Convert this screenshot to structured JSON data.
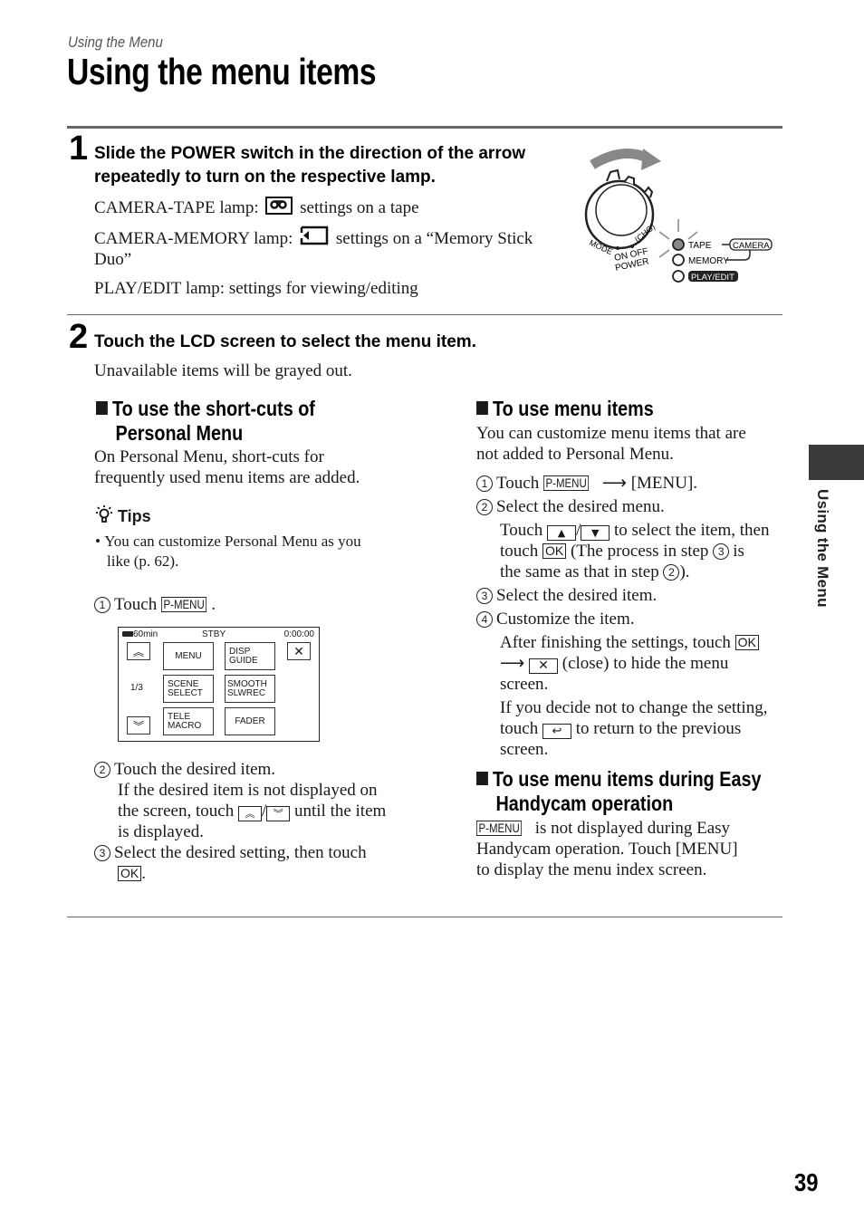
{
  "header": {
    "running_head": "Using the Menu",
    "title": "Using the menu items"
  },
  "step1": {
    "number": "1",
    "heading_line1": "Slide the POWER switch in the direction of the arrow",
    "heading_line2": "repeatedly to turn on the respective lamp.",
    "lines": [
      {
        "label": "CAMERA-TAPE lamp:",
        "icon": "tape-icon",
        "text": "settings on a tape"
      },
      {
        "label": "CAMERA-MEMORY lamp:",
        "icon": "memory-stick-icon",
        "text": "settings on a “Memory Stick",
        "text_cont": "Duo”"
      },
      {
        "label": "PLAY/EDIT lamp: settings for viewing/editing"
      }
    ],
    "diagram": {
      "mode": "MODE",
      "chg": "(CHG)",
      "on_off": "ON OFF",
      "power": "POWER",
      "tape": "TAPE",
      "memory": "MEMORY",
      "play_edit": "PLAY/EDIT",
      "camera": "CAMERA"
    }
  },
  "step2": {
    "number": "2",
    "heading": "Touch the LCD screen to select the menu item.",
    "subtext": "Unavailable items will be grayed out."
  },
  "left_col": {
    "section_title_line1": "To use the short-cuts of",
    "section_title_line2": "Personal Menu",
    "intro_line1": "On Personal Menu, short-cuts for",
    "intro_line2": "frequently used menu items are added.",
    "tips_label": "Tips",
    "tip_line1": "You can customize Personal Menu as you",
    "tip_line2": "like (p. 62).",
    "step1_touch": "Touch",
    "pmenu": "P-MENU",
    "step1_end": ".",
    "lcd": {
      "battery": "60min",
      "status": "STBY",
      "time": "0:00:00",
      "page": "1/3",
      "buttons": [
        {
          "line1": "MENU",
          "line2": ""
        },
        {
          "line1": "DISP",
          "line2": "GUIDE"
        },
        {
          "line1": "SCENE",
          "line2": "SELECT"
        },
        {
          "line1": "SMOOTH",
          "line2": "SLWREC"
        },
        {
          "line1": "TELE",
          "line2": "MACRO"
        },
        {
          "line1": "FADER",
          "line2": ""
        }
      ]
    },
    "step2_text": "Touch the desired item.",
    "step2_detail_line1": "If the desired item is not displayed on",
    "step2_detail_line2a": "the screen, touch",
    "step2_detail_line2b": "until the item",
    "step2_detail_line3": "is displayed.",
    "step3_text": "Select the desired setting, then touch",
    "ok": "OK",
    "step3_end": "."
  },
  "right_col": {
    "section1_title": "To use menu items",
    "section1_intro_line1": "You can customize menu items that are",
    "section1_intro_line2": "not added to Personal Menu.",
    "s1_touch": "Touch",
    "pmenu": "P-MENU",
    "s1_menu": "[MENU].",
    "s2_text": "Select the desired menu.",
    "s2_d1a": "Touch",
    "s2_d1b": "to select the item, then",
    "s2_d2a": "touch",
    "ok": "OK",
    "s2_d2b": "(The process in step",
    "s2_d2c": "is",
    "s2_d3a": "the same as that in step",
    "s2_d3b": ").",
    "s3_text": "Select the desired item.",
    "s4_text": "Customize the item.",
    "s4_d1": "After finishing the settings, touch",
    "s4_d2": "(close) to hide the menu",
    "s4_d3": "screen.",
    "s4_d4": "If you decide not to change the setting,",
    "s4_d5a": "touch",
    "s4_d5b": "to return to the previous",
    "s4_d6": "screen.",
    "section2_title_line1": "To use menu items during Easy",
    "section2_title_line2": "Handycam operation",
    "section2_line1": "is not displayed during Easy",
    "section2_line2": "Handycam operation. Touch [MENU]",
    "section2_line3": "to display the menu index screen."
  },
  "sidebar": {
    "label": "Using the Menu"
  },
  "footer": {
    "page_number": "39"
  }
}
